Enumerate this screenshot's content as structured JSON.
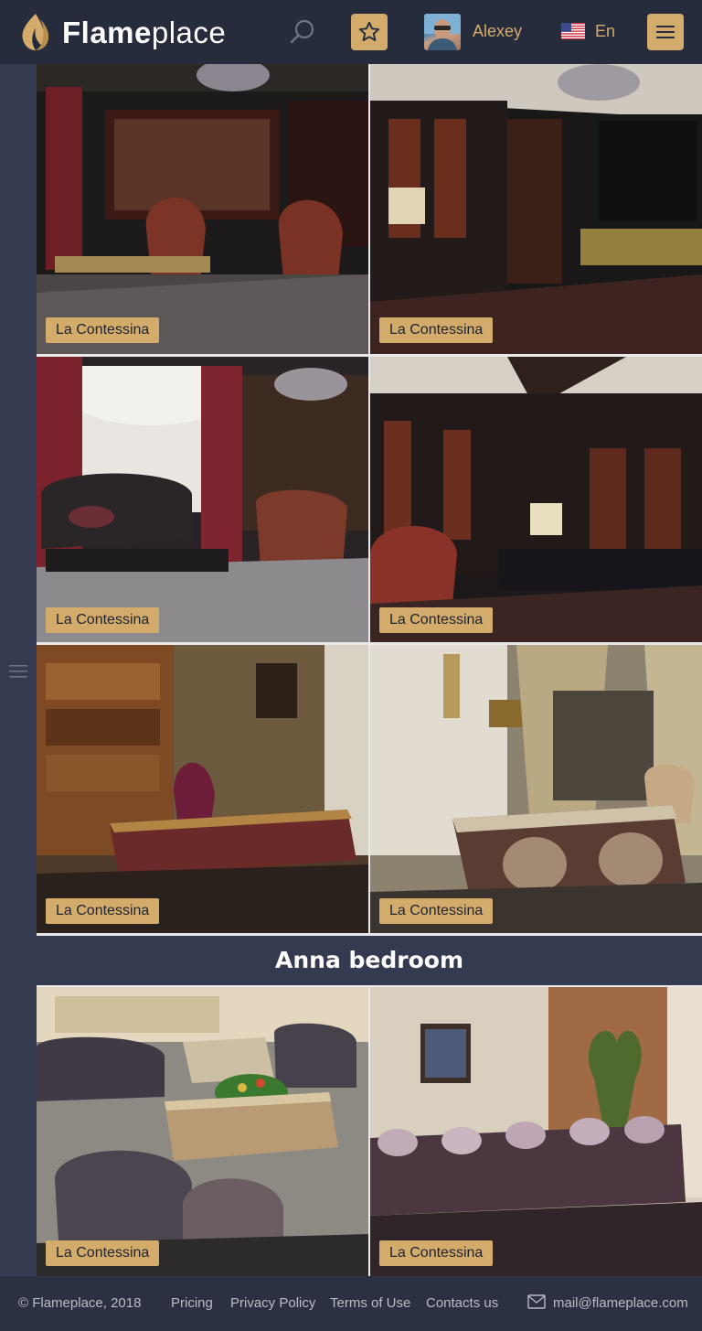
{
  "header": {
    "logo_strong": "Flame",
    "logo_light": "place",
    "user_name": "Alexey",
    "language": "En",
    "icons": {
      "logo": "flame-logo-icon",
      "search": "search-icon",
      "favorites": "star-icon",
      "language_flag": "us-flag-icon",
      "menu": "hamburger-menu-icon"
    }
  },
  "siderail": {
    "toggle_icon": "hamburger-menu-icon"
  },
  "gallery": {
    "tiles": [
      {
        "label": "La Contessina"
      },
      {
        "label": "La Contessina"
      },
      {
        "label": "La Contessina"
      },
      {
        "label": "La Contessina"
      },
      {
        "label": "La Contessina"
      },
      {
        "label": "La Contessina"
      }
    ],
    "section_title": "Anna bedroom",
    "section_tiles": [
      {
        "label": "La Contessina"
      },
      {
        "label": "La Contessina"
      }
    ]
  },
  "footer": {
    "copyright": "© Flameplace, 2018",
    "links": [
      "Pricing",
      "Privacy Policy",
      "Terms of Use",
      "Contacts us"
    ],
    "email": "mail@flameplace.com",
    "email_icon": "envelope-icon"
  },
  "colors": {
    "accent": "#d3ac6c",
    "header_bg": "#272c3d",
    "page_bg": "#2b3042",
    "rail_bg": "#343a50"
  }
}
